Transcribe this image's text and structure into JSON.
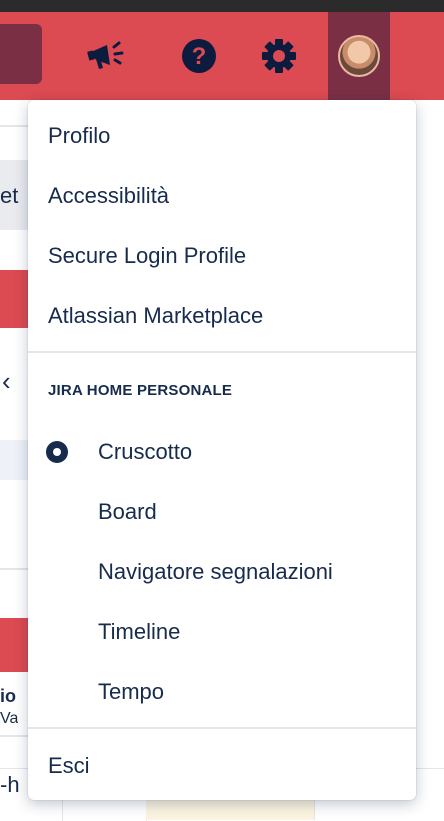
{
  "header": {
    "notifications_icon": "megaphone-icon",
    "help_icon": "question-circle-icon",
    "settings_icon": "gear-icon",
    "profile_icon": "avatar"
  },
  "background_fragments": {
    "tab_fragment": "et",
    "chevron": "‹",
    "row_text_1": "io",
    "row_text_2": "Va",
    "row_text_3": "-h"
  },
  "profile_menu": {
    "items_top": [
      {
        "label": "Profilo"
      },
      {
        "label": "Accessibilità"
      },
      {
        "label": "Secure Login Profile"
      },
      {
        "label": "Atlassian Marketplace"
      }
    ],
    "section_title": "JIRA HOME PERSONALE",
    "home_options": [
      {
        "label": "Cruscotto",
        "selected": true
      },
      {
        "label": "Board",
        "selected": false
      },
      {
        "label": "Navigatore segnalazioni",
        "selected": false
      },
      {
        "label": "Timeline",
        "selected": false
      },
      {
        "label": "Tempo",
        "selected": false
      }
    ],
    "logout_label": "Esci"
  },
  "colors": {
    "header_bg": "#dc4a52",
    "header_active": "#7a2f45",
    "text": "#172b4d"
  }
}
